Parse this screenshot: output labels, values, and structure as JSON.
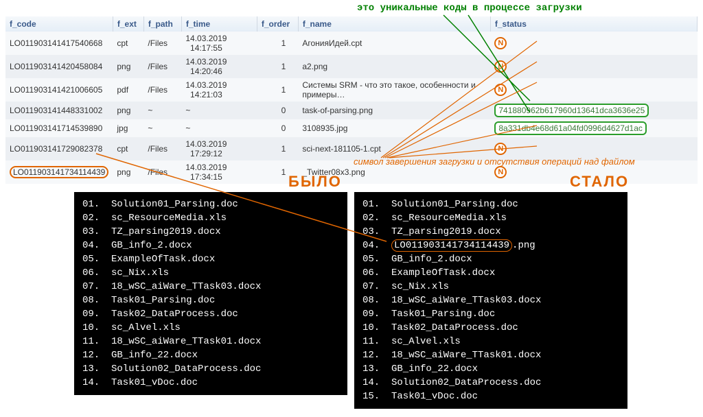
{
  "annot_top": "это  уникальные  коды  в  процессе  загрузки",
  "annot_symbol": "символ завершения загрузки и отсутствия операций над файлом",
  "title_left": "БЫЛО",
  "title_right": "СТАЛО",
  "badge_n": "N",
  "table": {
    "headers": [
      "f_code",
      "f_ext",
      "f_path",
      "f_time",
      "f_order",
      "f_name",
      "f_status"
    ],
    "rows": [
      {
        "code": "LO011903141417540668",
        "ext": "cpt",
        "path": "/Files",
        "time1": "14.03.2019",
        "time2": "14:17:55",
        "order": "1",
        "name": "АгонияИдей.cpt",
        "status": "N"
      },
      {
        "code": "LO011903141420458084",
        "ext": "png",
        "path": "/Files",
        "time1": "14.03.2019",
        "time2": "14:20:46",
        "order": "1",
        "name": "a2.png",
        "status": "N"
      },
      {
        "code": "LO011903141421006605",
        "ext": "pdf",
        "path": "/Files",
        "time1": "14.03.2019",
        "time2": "14:21:03",
        "order": "1",
        "name": "Системы SRM - что это такое, особенности и примеры…",
        "status": "N"
      },
      {
        "code": "LO011903141448331002",
        "ext": "png",
        "path": "~",
        "time1": "~",
        "time2": "",
        "order": "0",
        "name": "task-of-parsing.png",
        "status": "741880962b617960d13641dca3636e25"
      },
      {
        "code": "LO011903141714539890",
        "ext": "jpg",
        "path": "~",
        "time1": "~",
        "time2": "",
        "order": "0",
        "name": "3108935.jpg",
        "status": "8a331db4e68d61a04fd0996d4627d1ac"
      },
      {
        "code": "LO011903141729082378",
        "ext": "cpt",
        "path": "/Files",
        "time1": "14.03.2019",
        "time2": "17:29:12",
        "order": "1",
        "name": "sci-next-181105-1.cpt",
        "status": "N"
      },
      {
        "code": "LO011903141734114439",
        "ext": "png",
        "path": "/Files",
        "time1": "14.03.2019",
        "time2": "17:34:15",
        "order": "1",
        "name": "_Twitter08x3.png",
        "status": "N"
      }
    ]
  },
  "term_left": [
    {
      "n": "01.",
      "t": "Solution01_Parsing.doc"
    },
    {
      "n": "02.",
      "t": "sc_ResourceMedia.xls"
    },
    {
      "n": "03.",
      "t": "TZ_parsing2019.docx"
    },
    {
      "n": "04.",
      "t": "GB_info_2.docx"
    },
    {
      "n": "05.",
      "t": "ExampleOfTask.docx"
    },
    {
      "n": "06.",
      "t": "sc_Nix.xls"
    },
    {
      "n": "07.",
      "t": "18_wSC_aiWare_TTask03.docx"
    },
    {
      "n": "08.",
      "t": "Task01_Parsing.doc"
    },
    {
      "n": "09.",
      "t": "Task02_DataProcess.doc"
    },
    {
      "n": "10.",
      "t": "sc_Alvel.xls"
    },
    {
      "n": "11.",
      "t": "18_wSC_aiWare_TTask01.docx"
    },
    {
      "n": "12.",
      "t": "GB_info_22.docx"
    },
    {
      "n": "13.",
      "t": "Solution02_DataProcess.doc"
    },
    {
      "n": "14.",
      "t": "Task01_vDoc.doc"
    }
  ],
  "term_right": [
    {
      "n": "01.",
      "t": "Solution01_Parsing.doc",
      "hl": false
    },
    {
      "n": "02.",
      "t": "sc_ResourceMedia.xls",
      "hl": false
    },
    {
      "n": "03.",
      "t": "TZ_parsing2019.docx",
      "hl": false
    },
    {
      "n": "04.",
      "t": "LO011903141734114439",
      "suf": ".png",
      "hl": true
    },
    {
      "n": "05.",
      "t": "GB_info_2.docx",
      "hl": false
    },
    {
      "n": "06.",
      "t": "ExampleOfTask.docx",
      "hl": false
    },
    {
      "n": "07.",
      "t": "sc_Nix.xls",
      "hl": false
    },
    {
      "n": "08.",
      "t": "18_wSC_aiWare_TTask03.docx",
      "hl": false
    },
    {
      "n": "09.",
      "t": "Task01_Parsing.doc",
      "hl": false
    },
    {
      "n": "10.",
      "t": "Task02_DataProcess.doc",
      "hl": false
    },
    {
      "n": "11.",
      "t": "sc_Alvel.xls",
      "hl": false
    },
    {
      "n": "12.",
      "t": "18_wSC_aiWare_TTask01.docx",
      "hl": false
    },
    {
      "n": "13.",
      "t": "GB_info_22.docx",
      "hl": false
    },
    {
      "n": "14.",
      "t": "Solution02_DataProcess.doc",
      "hl": false
    },
    {
      "n": "15.",
      "t": "Task01_vDoc.doc",
      "hl": false
    }
  ]
}
